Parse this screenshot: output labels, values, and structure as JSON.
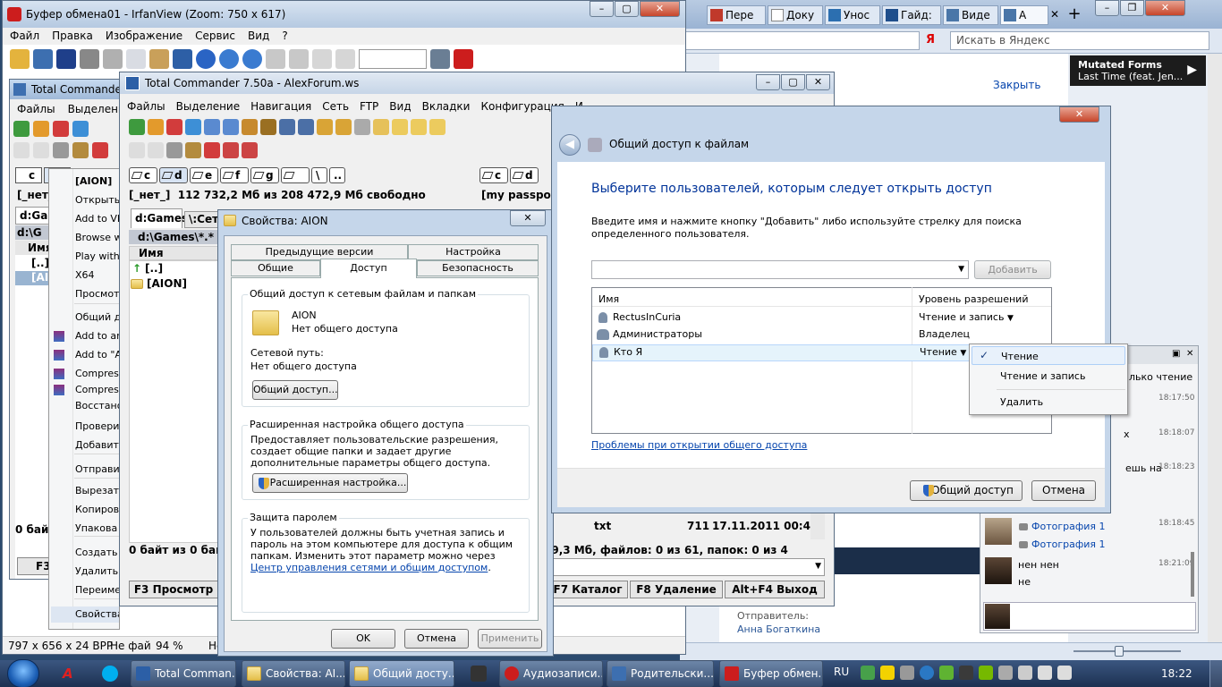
{
  "colors": {
    "accent": "#003399",
    "link": "#0645ad",
    "taskbar": "#253c5f"
  },
  "irfan": {
    "title": "Буфер обмена01 - IrfanView (Zoom: 750 x 617)",
    "menu": [
      "Файл",
      "Правка",
      "Изображение",
      "Сервис",
      "Вид",
      "?"
    ],
    "status": [
      "797 x 656 x 24 BPP",
      "Не фай",
      "94 %",
      "Не фо"
    ]
  },
  "tc_back": {
    "title": "Total Commander 7",
    "menu": [
      "Файлы",
      "Выделение"
    ],
    "drive_btns": [
      "c",
      "d"
    ],
    "label": "[_нет_]",
    "path": "d:Ga",
    "filter": "d:\\G",
    "col_name": "Имя",
    "up": "[..]",
    "aion": "[AI",
    "footer": "0 байт",
    "f3": "F3 I"
  },
  "ctx": {
    "items": [
      "[AION]",
      "Открыть",
      "Add to VL",
      "Browse wi",
      "Play with",
      "X64",
      "Просмотр",
      "Общий до",
      "Add to arc",
      "Add to \"AI",
      "Compress",
      "Compress",
      "Восстано",
      "Проверит",
      "Добавить",
      "Отправит",
      "Вырезать",
      "Копирова",
      "Упакова",
      "Создать я",
      "Удалить",
      "Переиме",
      "Свойства"
    ]
  },
  "tc": {
    "title": "Total Commander 7.50a - AlexForum.ws",
    "menu": [
      "Файлы",
      "Выделение",
      "Навигация",
      "Сеть",
      "FTP",
      "Вид",
      "Вкладки",
      "Конфигурация",
      "И"
    ],
    "drives": [
      "c",
      "d",
      "e",
      "f",
      "g",
      "",
      "\\",
      ".."
    ],
    "drives_r": [
      "c",
      "d"
    ],
    "label": "[_нет_]",
    "free": "112 732,2 Мб из 208 472,9 Мб свободно",
    "label_r": "[my passport]",
    "tab": "d:Games",
    "tab2": "\\:Сет",
    "path": "d:\\Games\\*.*",
    "col_name": "Имя",
    "up": "[..]",
    "aion": "[AION]",
    "footer": "0 байт из 0 байт",
    "footer_r": "59,3 Мб, файлов: 0 из 61, папок: 0 из 4",
    "row_name": "txt",
    "row_size": "711",
    "row_date": "17.11.2011 00:42",
    "fkeys": [
      "F3 Просмотр",
      "F7 Каталог",
      "F8 Удаление",
      "Alt+F4 Выход"
    ]
  },
  "props": {
    "title": "Свойства: AION",
    "tabs_row1": [
      "Предыдущие версии",
      "Настройка"
    ],
    "tabs_row2": [
      "Общие",
      "Доступ",
      "Безопасность"
    ],
    "g1_title": "Общий доступ к сетевым файлам и папкам",
    "folder_name": "AION",
    "folder_status": "Нет общего доступа",
    "netpath_label": "Сетевой путь:",
    "netpath_value": "Нет общего доступа",
    "share_btn": "Общий доступ...",
    "g2_title": "Расширенная настройка общего доступа",
    "g2_text": "Предоставляет пользовательские разрешения, создает общие папки и задает другие дополнительные параметры общего доступа.",
    "adv_btn": "Расширенная настройка...",
    "g3_title": "Защита паролем",
    "g3_text": "У пользователей должны быть учетная запись и пароль на этом компьютере для доступа к общим папкам. Изменить этот параметр можно через ",
    "g3_link": "Центр управления сетями и общим доступом",
    "g3_tail": ".",
    "ok": "OK",
    "cancel": "Отмена",
    "apply": "Применить"
  },
  "share": {
    "title": "Общий доступ к файлам",
    "heading": "Выберите пользователей, которым следует открыть доступ",
    "desc": "Введите имя и нажмите кнопку \"Добавить\" либо используйте стрелку для поиска определенного пользователя.",
    "add_btn": "Добавить",
    "col_name": "Имя",
    "col_perm": "Уровень разрешений",
    "rows": [
      {
        "name": "RectusInCuria",
        "perm": "Чтение и запись"
      },
      {
        "name": "Администраторы",
        "perm": "Владелец"
      },
      {
        "name": "Кто Я",
        "perm": "Чтение"
      }
    ],
    "link": "Проблемы при открытии общего доступа",
    "share_btn": "Общий доступ",
    "cancel_btn": "Отмена"
  },
  "dropdown": {
    "items": [
      "Чтение",
      "Чтение и запись",
      "Удалить"
    ]
  },
  "browser": {
    "tabs": [
      "Пере",
      "Доку",
      "Унос",
      "Гайд:",
      "Виде",
      "А"
    ],
    "search_placeholder": "Искать в Яндекс",
    "close_link": "Закрыть",
    "sender_label": "Отправитель:",
    "sender_name": "Анна Богаткина"
  },
  "music": {
    "title": "Mutated Forms",
    "subtitle": "Last Time (feat. Jen..."
  },
  "chat": {
    "top_text": "лько чтение",
    "times": [
      "18:17:50",
      "18:18:07",
      "18:18:23",
      "18:18:45",
      "18:21:09"
    ],
    "frags": [
      "х",
      "ешь на"
    ],
    "photo": "Фотография 1",
    "msg1": "нен нен",
    "msg2": "не"
  },
  "taskbar": {
    "items": [
      "Total Comman...",
      "Свойства: AI...",
      "Общий досту...",
      "",
      "Аудиозаписи...",
      "Родительски...",
      "Буфер обмен..."
    ],
    "lang": "RU",
    "time": "18:22"
  }
}
